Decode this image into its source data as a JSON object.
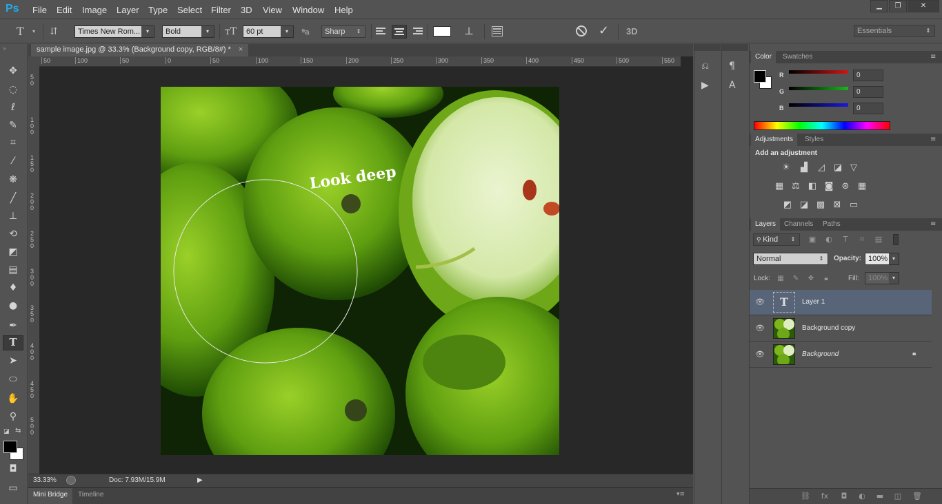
{
  "app": {
    "logo": "Ps"
  },
  "menu": [
    "File",
    "Edit",
    "Image",
    "Layer",
    "Type",
    "Select",
    "Filter",
    "3D",
    "View",
    "Window",
    "Help"
  ],
  "window_controls": {
    "minimize": "▁",
    "restore": "❐",
    "close": "✕"
  },
  "options": {
    "font_family": "Times New Rom...",
    "font_style": "Bold",
    "font_size": "60 pt",
    "aa_label": "ªa",
    "antialias": "Sharp",
    "text_color": "#ffffff",
    "cancel_icon": "cancel-icon",
    "commit_icon": "commit-icon",
    "threed_label": "3D",
    "workspace": "Essentials"
  },
  "document": {
    "tab_title": "sample image.jpg @ 33.3% (Background copy, RGB/8#) *",
    "close": "×",
    "curved_text": "Look deep",
    "ruler_h": [
      "50",
      "100",
      "50",
      "0",
      "50",
      "100",
      "150",
      "200",
      "250",
      "300",
      "350",
      "400",
      "450",
      "500",
      "550"
    ],
    "ruler_v": [
      "5 0",
      "1 0 0",
      "1 5 0",
      "2 0 0",
      "2 5 0",
      "3 0 0",
      "3 5 0",
      "4 0 0",
      "4 5 0",
      "5 0 0"
    ]
  },
  "status": {
    "zoom": "33.33%",
    "doc": "Doc: 7.93M/15.9M"
  },
  "bottom_tabs": [
    "Mini Bridge",
    "Timeline"
  ],
  "color_panel": {
    "tabs": [
      "Color",
      "Swatches"
    ],
    "channels": [
      {
        "label": "R",
        "value": "0",
        "color": "#d01616"
      },
      {
        "label": "G",
        "value": "0",
        "color": "#18b818"
      },
      {
        "label": "B",
        "value": "0",
        "color": "#1a1ad8"
      }
    ]
  },
  "adjustments_panel": {
    "tabs": [
      "Adjustments",
      "Styles"
    ],
    "heading": "Add an adjustment"
  },
  "layers_panel": {
    "tabs": [
      "Layers",
      "Channels",
      "Paths"
    ],
    "kind": "Kind",
    "blend_mode": "Normal",
    "opacity_label": "Opacity:",
    "opacity": "100%",
    "lock_label": "Lock:",
    "fill_label": "Fill:",
    "fill": "100%",
    "layers": [
      {
        "name": "Layer 1",
        "type": "text",
        "selected": true
      },
      {
        "name": "Background copy",
        "type": "image",
        "selected": false
      },
      {
        "name": "Background",
        "type": "image",
        "selected": false,
        "locked": true
      }
    ]
  }
}
